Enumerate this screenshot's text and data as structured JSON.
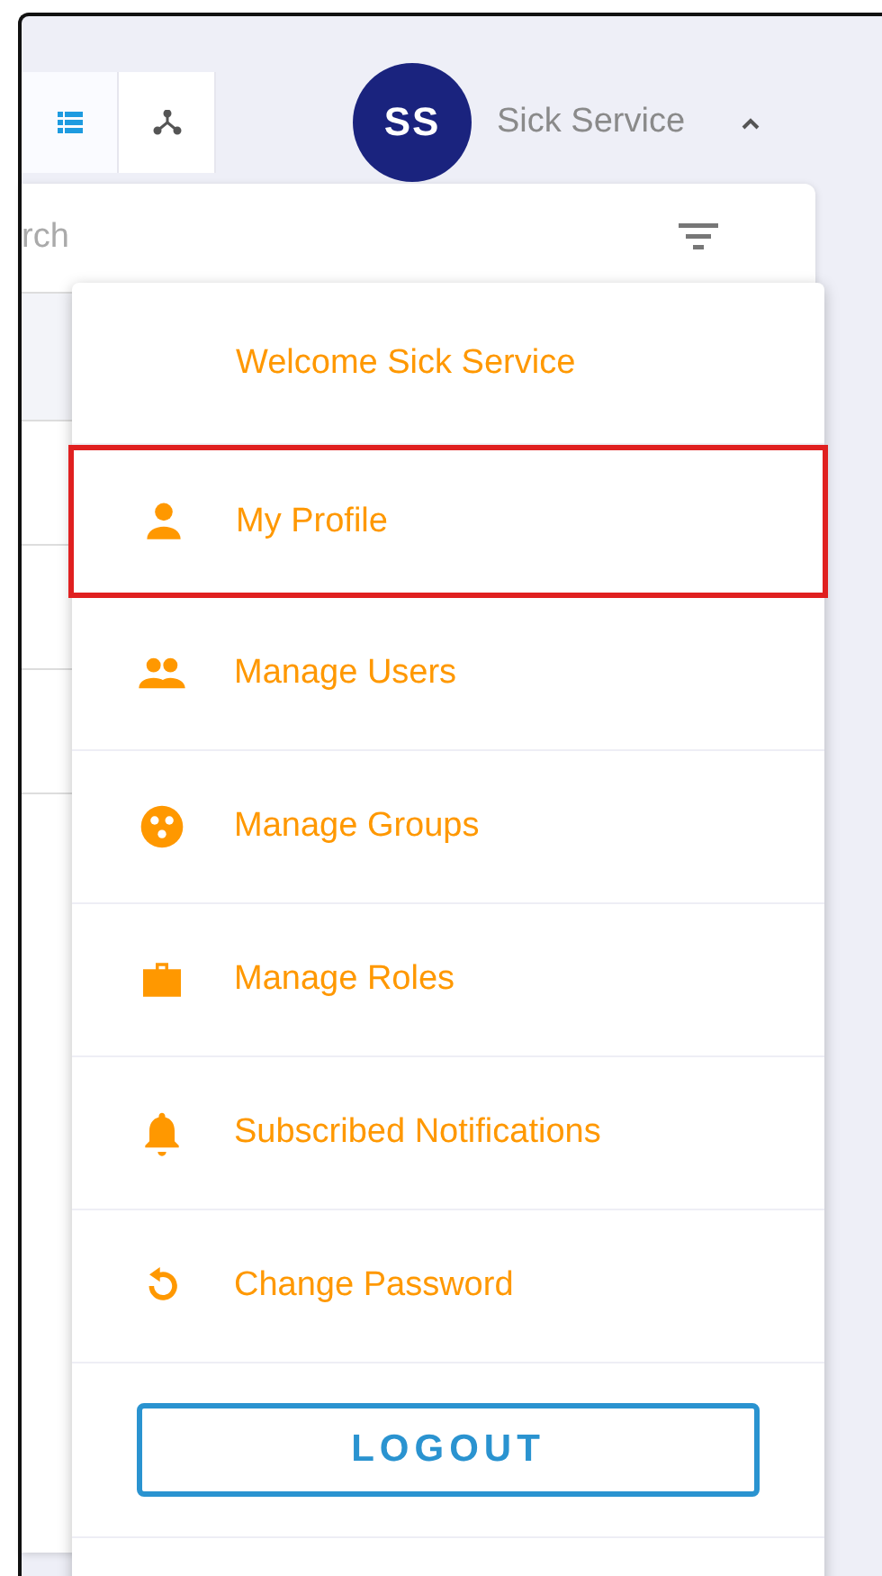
{
  "view_tabs": [
    {
      "selected": true
    },
    {
      "selected": false
    }
  ],
  "user": {
    "initials": "SS",
    "name": "Sick Service",
    "expanded": true
  },
  "search": {
    "placeholder": "rch"
  },
  "menu": {
    "welcome": "Welcome Sick Service",
    "items": [
      {
        "label": "My Profile",
        "highlighted": true
      },
      {
        "label": "Manage Users",
        "highlighted": false
      },
      {
        "label": "Manage Groups",
        "highlighted": false
      },
      {
        "label": "Manage Roles",
        "highlighted": false
      },
      {
        "label": "Subscribed Notifications",
        "highlighted": false
      },
      {
        "label": "Change Password",
        "highlighted": false
      }
    ],
    "logout": "LOGOUT"
  }
}
